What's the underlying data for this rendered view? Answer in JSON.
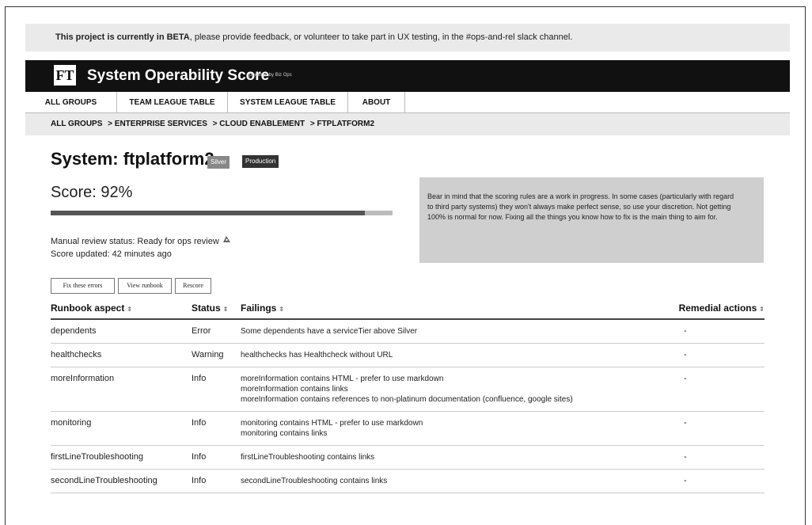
{
  "banner": {
    "bold": "This project is currently in BETA",
    "text": ", please provide feedback, or volunteer to take part in UX testing, in the #ops-and-rel slack channel."
  },
  "header": {
    "logo": "FT",
    "title": "System Operability Score",
    "subtitle": "powered by Biz Ops"
  },
  "nav": {
    "tabs": [
      {
        "label": "ALL GROUPS"
      },
      {
        "label": "TEAM LEAGUE TABLE"
      },
      {
        "label": "SYSTEM LEAGUE TABLE"
      },
      {
        "label": "ABOUT"
      }
    ]
  },
  "breadcrumb": {
    "items": [
      {
        "label": "ALL GROUPS"
      },
      {
        "label": "> ENTERPRISE SERVICES"
      },
      {
        "label": "> CLOUD ENABLEMENT"
      },
      {
        "label": "> FTPLATFORM2"
      }
    ]
  },
  "system": {
    "title": "System: ftplatform2",
    "tier_badge": "Silver",
    "lifecycle_badge": "Production",
    "score_label": "Score: 92%",
    "score_value": 0.92,
    "review_status": "Manual review status: Ready for ops review",
    "score_updated": "Score updated: 42 minutes ago"
  },
  "note": {
    "text": "Bear in mind that the scoring rules are a work in progress. In some cases (particularly with regard to third party systems) they won't always make perfect sense, so use your discretion. Not getting 100% is normal for now. Fixing all the things you know how to fix is the main thing to aim for."
  },
  "actions": {
    "fix_label": "Fix these errors",
    "runbook_label": "View runbook",
    "rescore_label": "Rescore"
  },
  "table": {
    "headers": {
      "aspect": "Runbook aspect",
      "status": "Status",
      "failings": "Failings",
      "remedial": "Remedial actions",
      "sort_glyph": "⇕"
    },
    "rows": [
      {
        "aspect": "dependents",
        "status": "Error",
        "failings": [
          "Some dependents have a serviceTier above Silver"
        ],
        "remedial": "-"
      },
      {
        "aspect": "healthchecks",
        "status": "Warning",
        "failings": [
          "healthchecks has Healthcheck without URL"
        ],
        "remedial": "-"
      },
      {
        "aspect": "moreInformation",
        "status": "Info",
        "failings": [
          "moreInformation contains HTML - prefer to use markdown",
          "moreInformation contains links",
          "moreInformation contains references to non-platinum documentation (confluence, google sites)"
        ],
        "remedial": "-"
      },
      {
        "aspect": "monitoring",
        "status": "Info",
        "failings": [
          "monitoring contains HTML - prefer to use markdown",
          "monitoring contains links"
        ],
        "remedial": "-"
      },
      {
        "aspect": "firstLineTroubleshooting",
        "status": "Info",
        "failings": [
          "firstLineTroubleshooting contains links"
        ],
        "remedial": "-"
      },
      {
        "aspect": "secondLineTroubleshooting",
        "status": "Info",
        "failings": [
          "secondLineTroubleshooting contains links"
        ],
        "remedial": "-"
      }
    ]
  }
}
